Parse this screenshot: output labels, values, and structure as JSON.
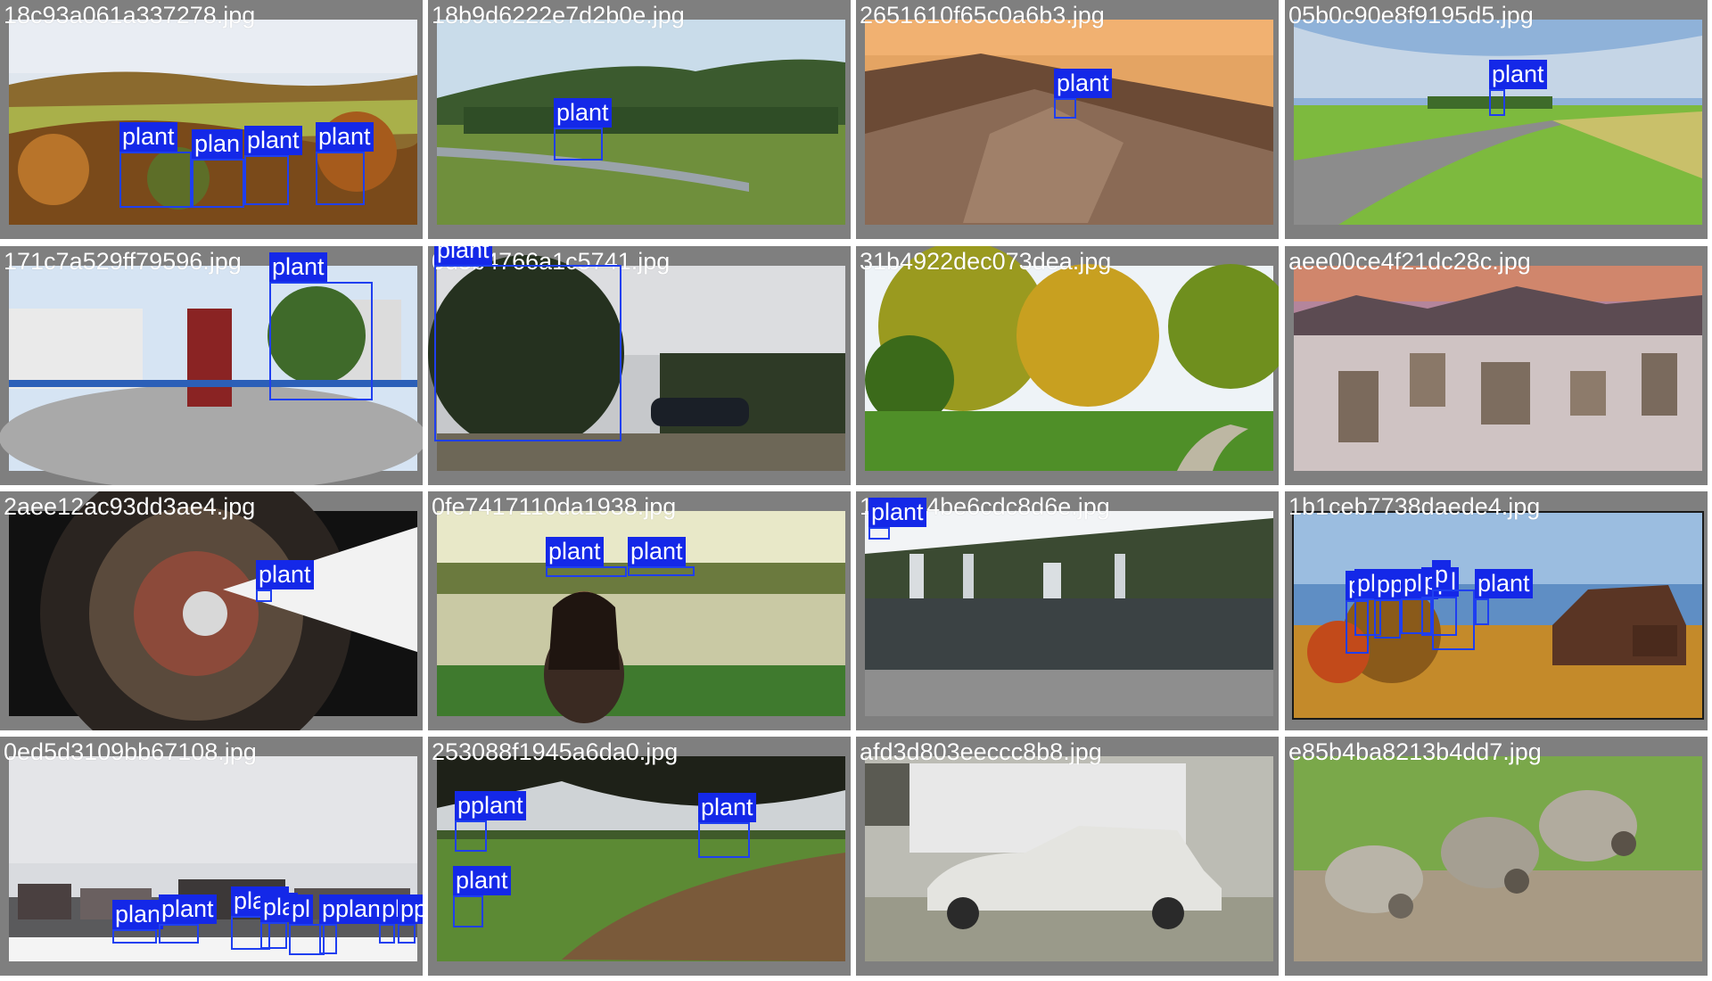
{
  "label_color": "#1428e8",
  "tiles": [
    {
      "filename": "18c93a061a337278.jpg",
      "scene": "autumn-field",
      "detections": [
        {
          "label": "plant"
        },
        {
          "label": "plan"
        },
        {
          "label": "plant"
        },
        {
          "label": "plant"
        }
      ]
    },
    {
      "filename": "18b9d6222e7d2b0e.jpg",
      "scene": "hill-village",
      "detections": [
        {
          "label": "plant"
        }
      ]
    },
    {
      "filename": "2651610f65c0a6b3.jpg",
      "scene": "rocky-ridge",
      "detections": [
        {
          "label": "plant"
        }
      ]
    },
    {
      "filename": "05b0c90e8f9195d5.jpg",
      "scene": "country-road",
      "detections": [
        {
          "label": "plant"
        }
      ]
    },
    {
      "filename": "171c7a529ff79596.jpg",
      "scene": "panorama-plaza",
      "detections": [
        {
          "label": "plant"
        }
      ]
    },
    {
      "filename": "0d5b4766a1c5741.jpg",
      "scene": "trees-car",
      "detections": [
        {
          "label": "plant"
        }
      ]
    },
    {
      "filename": "31b4922dec073dea.jpg",
      "scene": "autumn-park",
      "detections": [
        {
          "label": "plant"
        }
      ]
    },
    {
      "filename": "aee00ce4f21dc28c.jpg",
      "scene": "tufa-desert",
      "detections": []
    },
    {
      "filename": "2aee12ac93dd3ae4.jpg",
      "scene": "tiny-planet",
      "detections": [
        {
          "label": "plant"
        }
      ]
    },
    {
      "filename": "0fe7417110da1938.jpg",
      "scene": "river-woman",
      "detections": [
        {
          "label": "plant"
        },
        {
          "label": "plant"
        }
      ]
    },
    {
      "filename": "130a34be6cdc8d6e.jpg",
      "scene": "waterfall",
      "detections": [
        {
          "label": "plant"
        }
      ]
    },
    {
      "filename": "1b1ceb7738daede4.jpg",
      "scene": "barn-autumn",
      "detections": [
        {
          "label": "plant"
        },
        {
          "label": "plant"
        },
        {
          "label": "pplan"
        },
        {
          "label": "pl"
        },
        {
          "label": "ppl"
        },
        {
          "label": "p"
        },
        {
          "label": "plant"
        }
      ]
    },
    {
      "filename": "0ed5d3109bb67108.jpg",
      "scene": "snowy-town",
      "detections": [
        {
          "label": "plan"
        },
        {
          "label": "plant"
        },
        {
          "label": "plant"
        },
        {
          "label": "pla"
        },
        {
          "label": "pl"
        },
        {
          "label": "pplant"
        },
        {
          "label": "pla"
        },
        {
          "label": "pplant"
        }
      ]
    },
    {
      "filename": "253088f1945a6da0.jpg",
      "scene": "field-branches",
      "detections": [
        {
          "label": "pplant"
        },
        {
          "label": "plant"
        },
        {
          "label": "plant"
        }
      ]
    },
    {
      "filename": "afd3d803eeccc8b8.jpg",
      "scene": "old-car",
      "detections": []
    },
    {
      "filename": "e85b4ba8213b4dd7.jpg",
      "scene": "goslings",
      "detections": []
    }
  ]
}
